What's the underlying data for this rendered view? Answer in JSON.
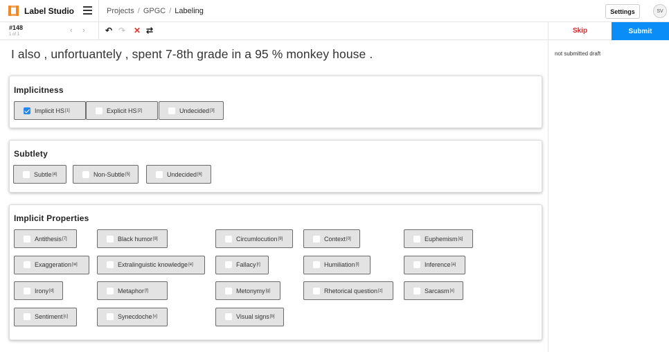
{
  "app": {
    "name": "Label Studio",
    "settings_label": "Settings",
    "avatar_initials": "SV"
  },
  "breadcrumb": [
    "Projects",
    "GPGC",
    "Labeling"
  ],
  "task": {
    "id": "#148",
    "count": "1 of 1"
  },
  "actions": {
    "skip": "Skip",
    "submit": "Submit"
  },
  "annotation_status": "not submitted draft",
  "text": "I also , unfortuantely , spent 7-8th grade in a 95 % monkey house .",
  "colors": {
    "accent": "#0a8df7",
    "skip": "#d4262d",
    "logo": "#f08a24"
  },
  "panels": [
    {
      "title": "Implicitness",
      "options": [
        {
          "label": "Implicit HS",
          "hotkey": "[1]",
          "checked": true
        },
        {
          "label": "Explicit HS",
          "hotkey": "[2]",
          "checked": false
        },
        {
          "label": "Undecided",
          "hotkey": "[3]",
          "checked": false
        }
      ]
    },
    {
      "title": "Subtlety",
      "options": [
        {
          "label": "Subtle",
          "hotkey": "[4]",
          "checked": false
        },
        {
          "label": "Non-Subtle",
          "hotkey": "[5]",
          "checked": false
        },
        {
          "label": "Undecided",
          "hotkey": "[6]",
          "checked": false
        }
      ]
    },
    {
      "title": "Implicit Properties",
      "options": [
        {
          "label": "Antithesis",
          "hotkey": "[7]",
          "checked": false
        },
        {
          "label": "Black humor",
          "hotkey": "[8]",
          "checked": false
        },
        {
          "label": "Circumlocution",
          "hotkey": "[9]",
          "checked": false
        },
        {
          "label": "Context",
          "hotkey": "[0]",
          "checked": false
        },
        {
          "label": "Euphemism",
          "hotkey": "[q]",
          "checked": false
        },
        {
          "label": "Exaggeration",
          "hotkey": "[w]",
          "checked": false
        },
        {
          "label": "Extralinguistic knowledge",
          "hotkey": "[e]",
          "checked": false
        },
        {
          "label": "Fallacy",
          "hotkey": "[r]",
          "checked": false
        },
        {
          "label": "Humiliation",
          "hotkey": "[t]",
          "checked": false
        },
        {
          "label": "Inference",
          "hotkey": "[a]",
          "checked": false
        },
        {
          "label": "Irony",
          "hotkey": "[d]",
          "checked": false
        },
        {
          "label": "Metaphor",
          "hotkey": "[f]",
          "checked": false
        },
        {
          "label": "Metonymy",
          "hotkey": "[g]",
          "checked": false
        },
        {
          "label": "Rhetorical question",
          "hotkey": "[z]",
          "checked": false
        },
        {
          "label": "Sarcasm",
          "hotkey": "[x]",
          "checked": false
        },
        {
          "label": "Sentiment",
          "hotkey": "[c]",
          "checked": false
        },
        {
          "label": "Synecdoche",
          "hotkey": "[v]",
          "checked": false
        },
        {
          "label": "Visual signs",
          "hotkey": "[b]",
          "checked": false
        }
      ]
    }
  ]
}
